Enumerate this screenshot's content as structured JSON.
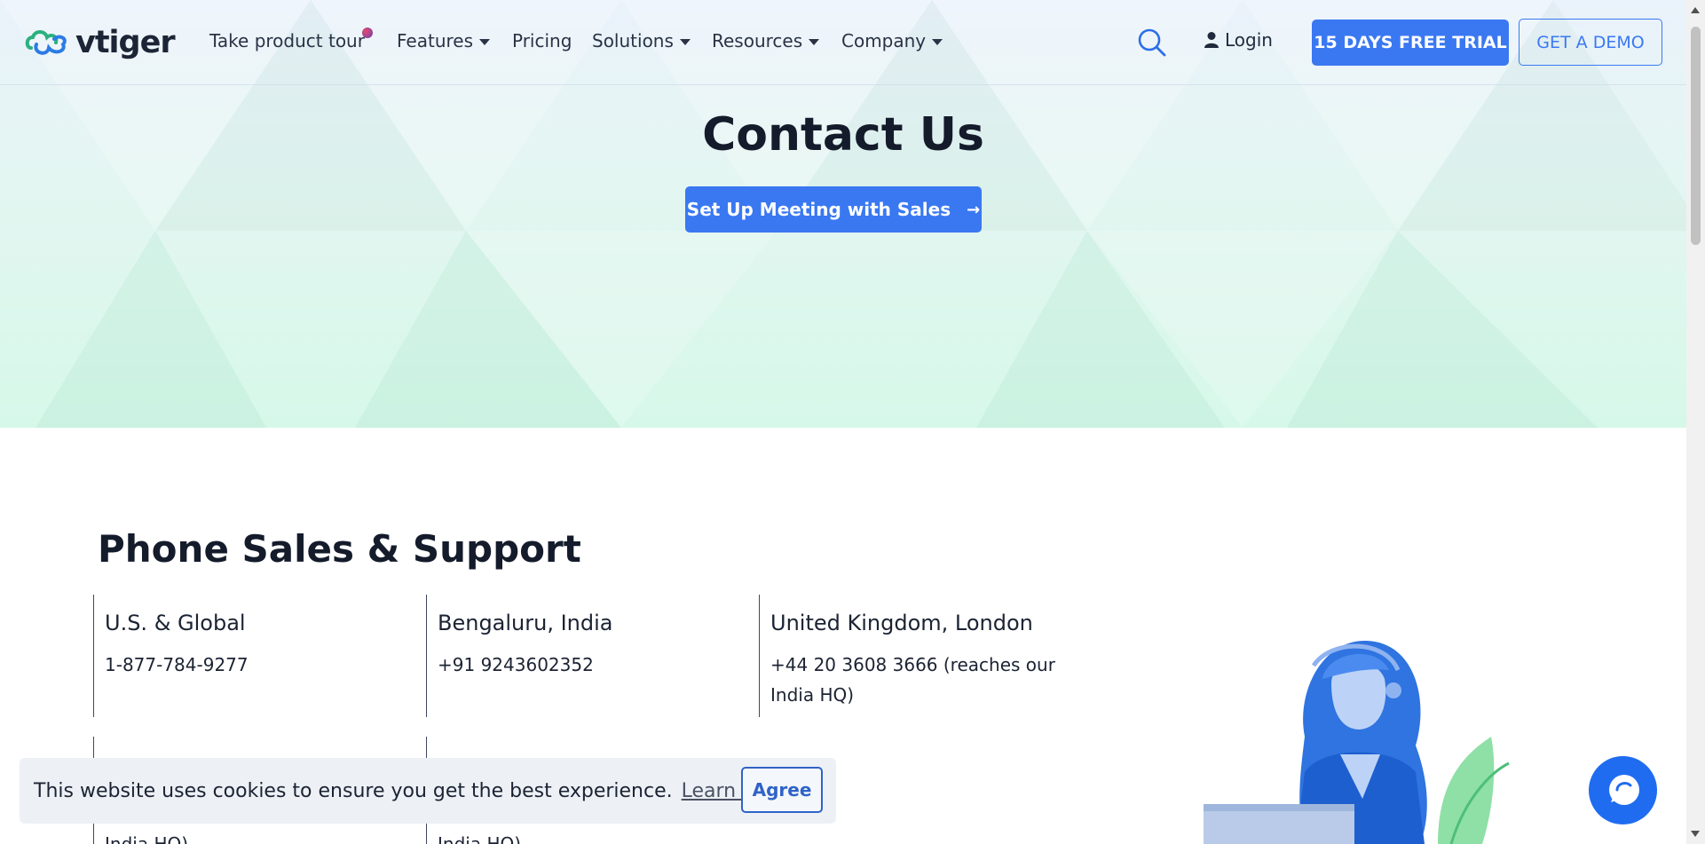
{
  "nav": {
    "logo_text": "vtiger",
    "links": [
      {
        "label": "Take product tour",
        "has_caret": false
      },
      {
        "label": "Features",
        "has_caret": true
      },
      {
        "label": "Pricing",
        "has_caret": false
      },
      {
        "label": "Solutions",
        "has_caret": true
      },
      {
        "label": "Resources",
        "has_caret": true
      },
      {
        "label": "Company",
        "has_caret": true
      }
    ],
    "search_icon": "search-icon",
    "login_label": "Login",
    "trial_label": "15 DAYS FREE TRIAL",
    "demo_label": "GET A DEMO"
  },
  "hero": {
    "title": "Contact Us",
    "cta_label": "Set Up Meeting with Sales",
    "cta_arrow": "→"
  },
  "phone": {
    "title": "Phone Sales & Support",
    "offices": [
      {
        "name": "U.S. & Global",
        "phone": "1-877-784-9277"
      },
      {
        "name": "Bengaluru, India",
        "phone": "+91 9243602352"
      },
      {
        "name": "United Kingdom, London",
        "phone": "+44 20 3608 3666 (reaches our India HQ)"
      }
    ],
    "partial_rows": [
      "India HQ)",
      "India HQ)"
    ]
  },
  "cookie": {
    "text": "This website uses cookies to ensure you get the best experience.",
    "learn_more": "Learn more",
    "agree": "Agree"
  },
  "colors": {
    "accent": "#3a78f2",
    "text": "#1b2333",
    "hero_top": "#eaf2fb",
    "hero_bottom": "#d6f8e9"
  }
}
